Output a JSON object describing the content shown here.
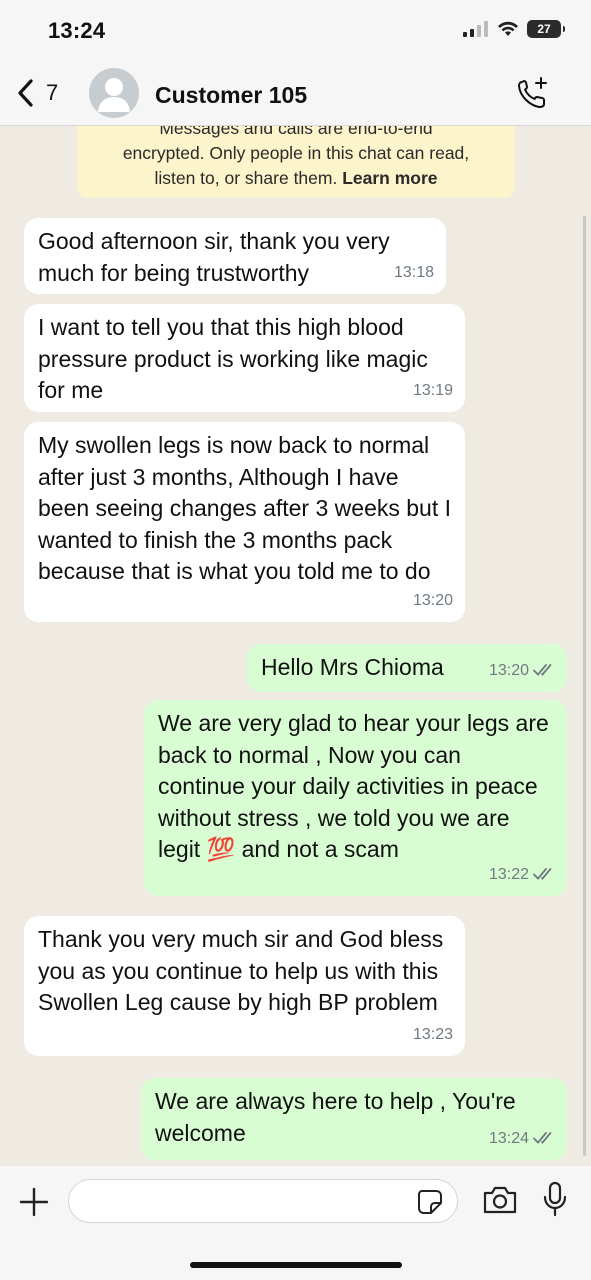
{
  "status_bar": {
    "time": "13:24",
    "battery": "27"
  },
  "header": {
    "back_count": "7",
    "contact_name": "Customer 105"
  },
  "banner": {
    "line1": "Messages and calls are end-to-end",
    "line2": "encrypted. Only people in this chat can read,",
    "line3": "listen to, or share them.",
    "link": "Learn more"
  },
  "messages": [
    {
      "direction": "in",
      "text": "Good afternoon sir, thank you very much for being trustworthy",
      "time": "13:18"
    },
    {
      "direction": "in",
      "text": "I want to tell you that this high blood pressure product is working like magic for me",
      "time": "13:19"
    },
    {
      "direction": "in",
      "text": "My swollen legs is now back to normal after just 3 months, Although I have been seeing changes after 3 weeks but I wanted to finish the 3 months pack because that is what you told me to do",
      "time": "13:20"
    },
    {
      "direction": "out",
      "text": "Hello Mrs Chioma",
      "time": "13:20"
    },
    {
      "direction": "out",
      "text": "We are very glad to hear your legs are back to normal , Now you can continue your daily activities in peace without stress  , we told you we are legit 💯 and not a scam",
      "time": "13:22"
    },
    {
      "direction": "in",
      "text": "Thank you very much sir and God bless you as you continue to help us with this Swollen Leg cause by high BP problem",
      "time": "13:23"
    },
    {
      "direction": "out",
      "text": "We are always here to help , You're welcome",
      "time": "13:24"
    }
  ],
  "icons": {
    "back": "chevron-left-icon",
    "call_add": "phone-plus-icon",
    "plus": "plus-icon",
    "sticker": "sticker-icon",
    "camera": "camera-icon",
    "mic": "microphone-icon",
    "read": "double-check-icon"
  },
  "colors": {
    "incoming_bubble": "#ffffff",
    "outgoing_bubble": "#d9fdd3",
    "banner": "#fcf4cb",
    "chat_background": "#efeae2"
  }
}
